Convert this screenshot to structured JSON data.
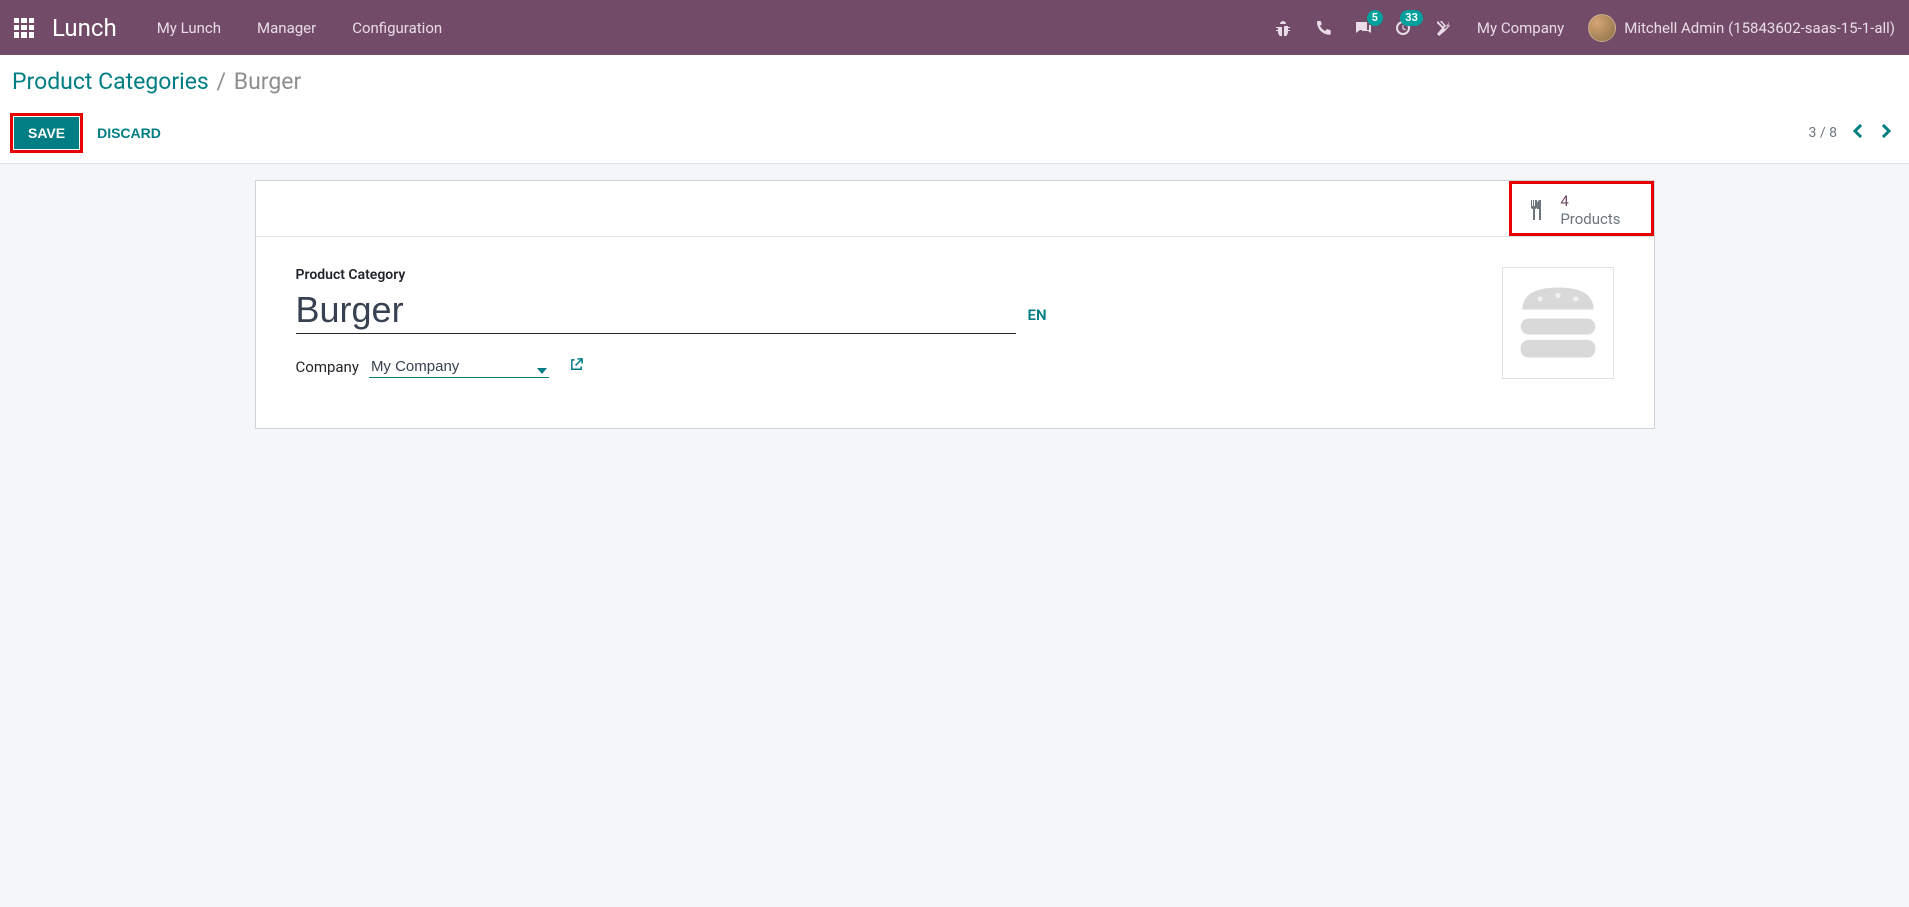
{
  "topnav": {
    "brand": "Lunch",
    "items": [
      "My Lunch",
      "Manager",
      "Configuration"
    ],
    "messaging_count": "5",
    "activities_count": "33",
    "company": "My Company",
    "username": "Mitchell Admin (15843602-saas-15-1-all)"
  },
  "breadcrumb": {
    "parent": "Product Categories",
    "current": "Burger"
  },
  "buttons": {
    "save": "SAVE",
    "discard": "DISCARD"
  },
  "pager": {
    "text": "3 / 8"
  },
  "stat": {
    "count": "4",
    "label": "Products"
  },
  "form": {
    "title_label": "Product Category",
    "title_value": "Burger",
    "lang_btn": "EN",
    "company_label": "Company",
    "company_value": "My Company"
  }
}
